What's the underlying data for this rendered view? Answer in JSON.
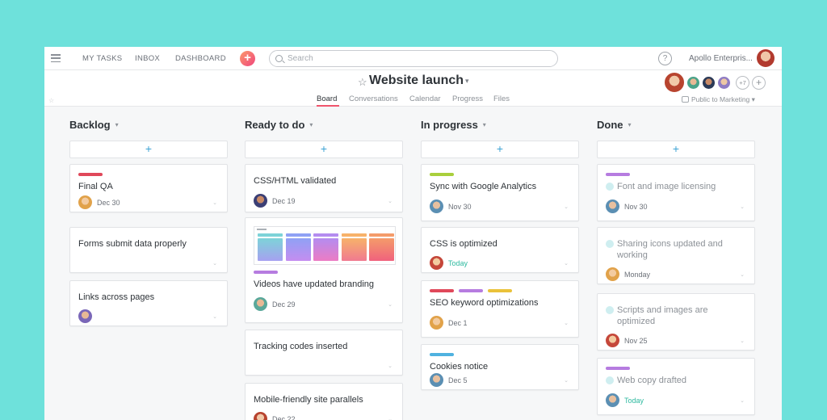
{
  "nav": {
    "links": [
      "MY TASKS",
      "INBOX",
      "DASHBOARD"
    ],
    "search_placeholder": "Search",
    "help_label": "?",
    "org_name": "Apollo Enterpris..."
  },
  "project": {
    "title": "Website launch",
    "tabs": [
      "Board",
      "Conversations",
      "Calendar",
      "Progress",
      "Files"
    ],
    "active_tab": "Board",
    "extra_members": "+7",
    "privacy": "Public to Marketing"
  },
  "colors": {
    "accent": "#f0556d",
    "add": "#3ea3d4",
    "today": "#2cb99f",
    "background": "#6ee1db"
  },
  "columns": [
    {
      "name": "Backlog",
      "add_label": "+",
      "cards": [
        {
          "title": "Final QA",
          "tags": [
            "#e0485a"
          ],
          "due": "Dec 30",
          "avatar": "avatar-1"
        },
        {
          "title": "Forms submit data properly",
          "tags": [],
          "due": "",
          "avatar": ""
        },
        {
          "title": "Links across pages",
          "tags": [],
          "due": "",
          "avatar": "avatar-2"
        }
      ]
    },
    {
      "name": "Ready to do",
      "add_label": "+",
      "cards": [
        {
          "title": "CSS/HTML validated",
          "tags": [],
          "due": "Dec 19",
          "avatar": "avatar-3"
        },
        {
          "title": "Videos have updated branding",
          "tags": [
            "#b67ce0"
          ],
          "due": "Dec 29",
          "avatar": "avatar-4",
          "has_image": true
        },
        {
          "title": "Tracking codes inserted",
          "tags": [],
          "due": "",
          "avatar": ""
        },
        {
          "title": "Mobile-friendly site parallels",
          "tags": [],
          "due": "Dec 22",
          "avatar": "avatar-5"
        }
      ]
    },
    {
      "name": "In progress",
      "add_label": "+",
      "cards": [
        {
          "title": "Sync with Google Analytics",
          "tags": [
            "#a9cf3c"
          ],
          "due": "Nov 30",
          "avatar": "avatar-6"
        },
        {
          "title": "CSS is optimized",
          "tags": [],
          "due": "Today",
          "avatar": "avatar-7"
        },
        {
          "title": "SEO keyword optimizations",
          "tags": [
            "#e0485a",
            "#b67ce0",
            "#eac23a"
          ],
          "due": "Dec 1",
          "avatar": "avatar-1"
        },
        {
          "title": "Cookies notice",
          "tags": [
            "#4fb2e0"
          ],
          "due": "Dec 5",
          "avatar": "avatar-6"
        }
      ]
    },
    {
      "name": "Done",
      "add_label": "+",
      "cards": [
        {
          "title": "Font and image licensing",
          "tags": [
            "#b67ce0"
          ],
          "due": "Nov 30",
          "avatar": "avatar-6"
        },
        {
          "title": "Sharing icons updated and working",
          "tags": [],
          "due": "Monday",
          "avatar": "avatar-1"
        },
        {
          "title": "Scripts and images are optimized",
          "tags": [],
          "due": "Nov 25",
          "avatar": "avatar-7"
        },
        {
          "title": "Web copy drafted",
          "tags": [
            "#b67ce0"
          ],
          "due": "Today",
          "avatar": "avatar-6"
        }
      ]
    }
  ]
}
